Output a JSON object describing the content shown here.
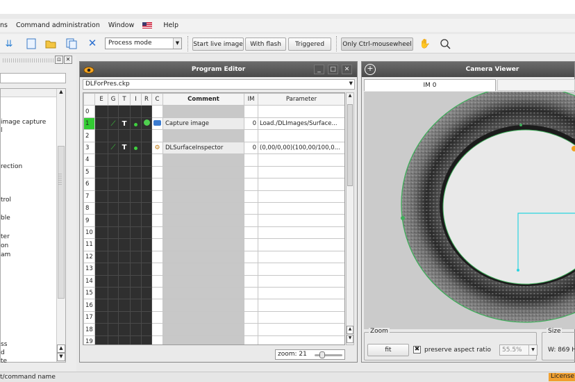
{
  "menu": {
    "items": [
      "ns",
      "Command administration",
      "Window",
      "Help"
    ]
  },
  "toolbar": {
    "process_mode": "Process mode",
    "start_live": "Start live image",
    "with_flash": "With flash",
    "triggered": "Triggered",
    "only_ctrl": "Only Ctrl-mousewheel"
  },
  "left_panel": {
    "items": [
      "image capture",
      "l",
      "rection",
      "trol",
      "ble",
      "ter",
      "on",
      "am",
      "ss",
      "d",
      "te"
    ]
  },
  "program_editor": {
    "title": "Program Editor",
    "file": "DLForPres.ckp",
    "columns": [
      "E",
      "G",
      "T",
      "I",
      "R",
      "C",
      "Comment",
      "IM",
      "Parameter"
    ],
    "rows": [
      {
        "n": "0",
        "comment": "",
        "im": "",
        "param": ""
      },
      {
        "n": "1",
        "comment": "Capture image",
        "im": "0",
        "param": "Load./DLImages/Surface..."
      },
      {
        "n": "2",
        "comment": "",
        "im": "",
        "param": ""
      },
      {
        "n": "3",
        "comment": "DLSurfaceInspector",
        "im": "0",
        "param": "(0,00/0,00)(100,00/100,0..."
      },
      {
        "n": "4",
        "comment": "",
        "im": "",
        "param": ""
      },
      {
        "n": "5",
        "comment": "",
        "im": "",
        "param": ""
      },
      {
        "n": "6",
        "comment": "",
        "im": "",
        "param": ""
      },
      {
        "n": "7",
        "comment": "",
        "im": "",
        "param": ""
      },
      {
        "n": "8",
        "comment": "",
        "im": "",
        "param": ""
      },
      {
        "n": "9",
        "comment": "",
        "im": "",
        "param": ""
      },
      {
        "n": "10",
        "comment": "",
        "im": "",
        "param": ""
      },
      {
        "n": "11",
        "comment": "",
        "im": "",
        "param": ""
      },
      {
        "n": "12",
        "comment": "",
        "im": "",
        "param": ""
      },
      {
        "n": "13",
        "comment": "",
        "im": "",
        "param": ""
      },
      {
        "n": "14",
        "comment": "",
        "im": "",
        "param": ""
      },
      {
        "n": "15",
        "comment": "",
        "im": "",
        "param": ""
      },
      {
        "n": "16",
        "comment": "",
        "im": "",
        "param": ""
      },
      {
        "n": "17",
        "comment": "",
        "im": "",
        "param": ""
      },
      {
        "n": "18",
        "comment": "",
        "im": "",
        "param": ""
      },
      {
        "n": "19",
        "comment": "",
        "im": "",
        "param": ""
      }
    ],
    "zoom_label": "zoom: 21"
  },
  "camera_viewer": {
    "title": "Camera Viewer",
    "tab": "IM 0",
    "zoom_group": "Zoom",
    "fit_button": "fit",
    "preserve_aspect": "preserve aspect ratio",
    "zoom_value": "55.5%",
    "size_group": "Size",
    "size_value": "W: 869  H"
  },
  "status": {
    "left": "t/command name",
    "license": "License"
  }
}
